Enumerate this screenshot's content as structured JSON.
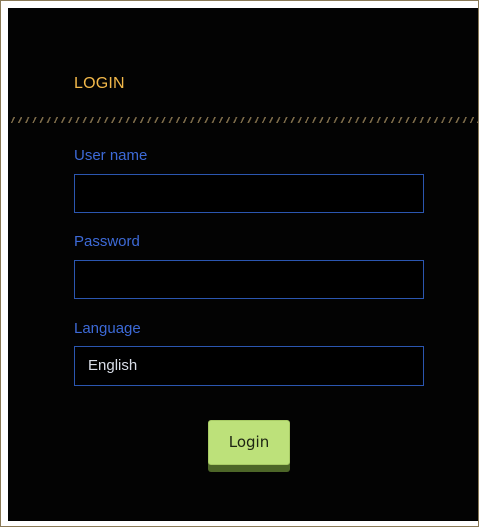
{
  "login": {
    "title": "LOGIN",
    "username_label": "User name",
    "username_value": "",
    "password_label": "Password",
    "password_value": "",
    "language_label": "Language",
    "language_selected": "English",
    "login_button": "Login"
  },
  "colors": {
    "background": "#030303",
    "title": "#f2b84a",
    "label": "#3d6ad7",
    "field_border": "#2b56b0",
    "button": "#bde17a",
    "button_shadow": "#4d6628",
    "divider": "#7b6a48"
  }
}
